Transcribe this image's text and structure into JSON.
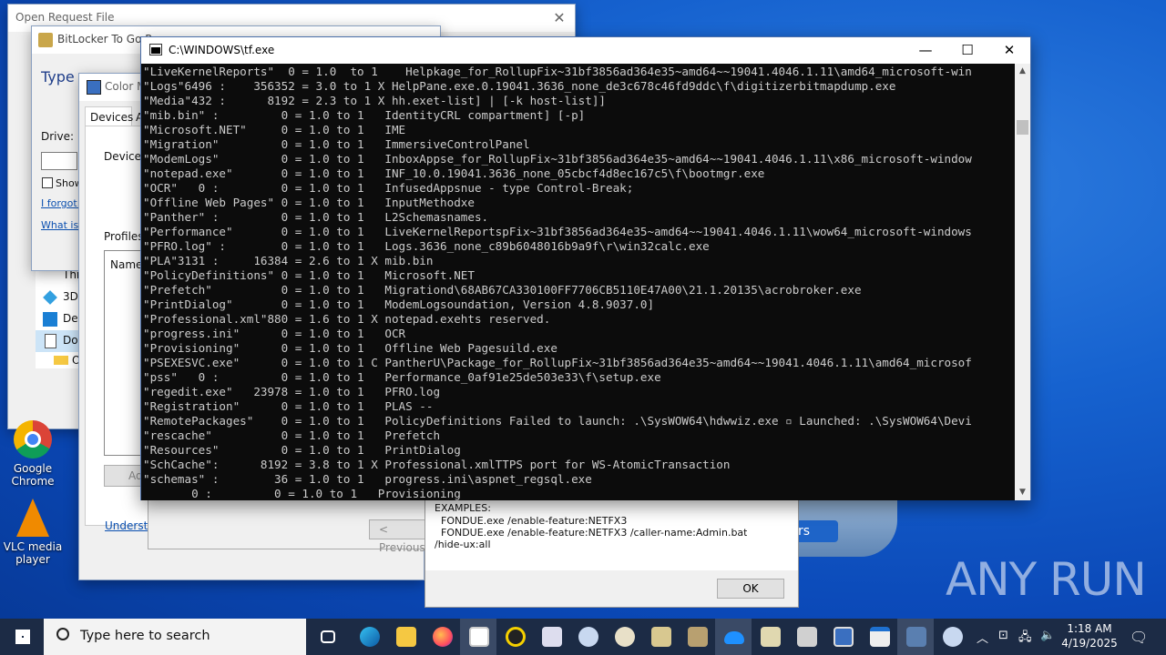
{
  "windows": {
    "open_request": {
      "title": "Open Request File"
    },
    "bitlocker": {
      "title": "BitLocker To Go Re",
      "heading": "Type y",
      "drive_label": "Drive:",
      "show_label": "Show",
      "forgot_link": "I forgot r",
      "what_link": "What is t"
    },
    "color_mgmt": {
      "title": "Color M",
      "tab_devices": "Devices",
      "tab_a": "A",
      "device_label": "Device:",
      "profiles_label": "Profiles",
      "name_header": "Name",
      "add_button": "Ad",
      "understand_link": "Understan",
      "previous_button": "< Previous"
    },
    "explorer_partial": {
      "items": [
        "This",
        "3D",
        "Des",
        "Doc",
        "O"
      ]
    }
  },
  "console": {
    "title": "C:\\WINDOWS\\tf.exe",
    "lines": [
      "\"LiveKernelReports\"  0 = 1.0  to 1    Helpkage_for_RollupFix~31bf3856ad364e35~amd64~~19041.4046.1.11\\amd64_microsoft-win",
      "\"Logs\"6496 :    356352 = 3.0 to 1 X HelpPane.exe.0.19041.3636_none_de3c678c46fd9ddc\\f\\digitizerbitmapdump.exe",
      "\"Media\"432 :      8192 = 2.3 to 1 X hh.exet-list] | [-k host-list]]",
      "\"mib.bin\" :         0 = 1.0 to 1   IdentityCRL compartment] [-p]",
      "\"Microsoft.NET\"     0 = 1.0 to 1   IME",
      "\"Migration\"         0 = 1.0 to 1   ImmersiveControlPanel",
      "\"ModemLogs\"         0 = 1.0 to 1   InboxAppse_for_RollupFix~31bf3856ad364e35~amd64~~19041.4046.1.11\\x86_microsoft-window",
      "\"notepad.exe\"       0 = 1.0 to 1   INF_10.0.19041.3636_none_05cbcf4d8ec167c5\\f\\bootmgr.exe",
      "\"OCR\"   0 :         0 = 1.0 to 1   InfusedAppsnue - type Control-Break;",
      "\"Offline Web Pages\" 0 = 1.0 to 1   InputMethodxe",
      "\"Panther\" :         0 = 1.0 to 1   L2Schemasnames.",
      "\"Performance\"       0 = 1.0 to 1   LiveKernelReportspFix~31bf3856ad364e35~amd64~~19041.4046.1.11\\wow64_microsoft-windows",
      "\"PFRO.log\" :        0 = 1.0 to 1   Logs.3636_none_c89b6048016b9a9f\\r\\win32calc.exe",
      "\"PLA\"3131 :     16384 = 2.6 to 1 X mib.bin",
      "\"PolicyDefinitions\" 0 = 1.0 to 1   Microsoft.NET",
      "\"Prefetch\"          0 = 1.0 to 1   Migrationd\\68AB67CA330100FF7706CB5110E47A00\\21.1.20135\\acrobroker.exe",
      "\"PrintDialog\"       0 = 1.0 to 1   ModemLogsoundation, Version 4.8.9037.0]",
      "\"Professional.xml\"880 = 1.6 to 1 X notepad.exehts reserved.",
      "\"progress.ini\"      0 = 1.0 to 1   OCR",
      "\"Provisioning\"      0 = 1.0 to 1   Offline Web Pagesuild.exe",
      "\"PSEXESVC.exe\"      0 = 1.0 to 1 C PantherU\\Package_for_RollupFix~31bf3856ad364e35~amd64~~19041.4046.1.11\\amd64_microsof",
      "\"pss\"   0 :         0 = 1.0 to 1   Performance_0af91e25de503e33\\f\\setup.exe",
      "\"regedit.exe\"   23978 = 1.0 to 1   PFRO.log",
      "\"Registration\"      0 = 1.0 to 1   PLAS --",
      "\"RemotePackages\"    0 = 1.0 to 1   PolicyDefinitions Failed to launch: .\\SysWOW64\\hdwwiz.exe ▫ Launched: .\\SysWOW64\\Devi",
      "\"rescache\"          0 = 1.0 to 1   Prefetch",
      "\"Resources\"         0 = 1.0 to 1   PrintDialog",
      "\"SchCache\":      8192 = 3.8 to 1 X Professional.xmlTTPS port for WS-AtomicTransaction",
      "\"schemas\" :        36 = 1.0 to 1   progress.ini\\aspnet_regsql.exe",
      "       0 :         0 = 1.0 to 1   Provisioning"
    ]
  },
  "msgbox": {
    "lines": [
      "EXAMPLES:",
      "  FONDUE.exe /enable-feature:NETFX3",
      "  FONDUE.exe /enable-feature:NETFX3 /caller-name:Admin.bat",
      "/hide-ux:all"
    ],
    "ok_label": "OK",
    "partial_button": "rs"
  },
  "desktop_icons": [
    {
      "label": "Google Chrome"
    },
    {
      "label": "VLC media player"
    }
  ],
  "taskbar": {
    "search_placeholder": "Type here to search",
    "time": "1:18 AM",
    "date": "4/19/2025"
  },
  "watermark": "ANY RUN",
  "colors": {
    "console_bg": "#0c0c0c",
    "console_fg": "#cccccc",
    "taskbar_bg": "#1c2b45",
    "desktop_bg": "#1662cf"
  }
}
